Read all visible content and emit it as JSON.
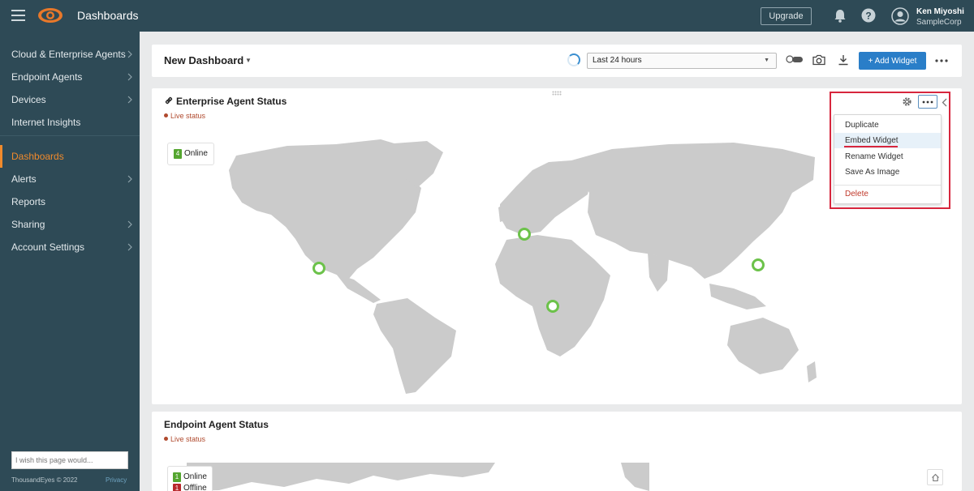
{
  "app": {
    "title": "Dashboards"
  },
  "topbar": {
    "upgrade_label": "Upgrade",
    "user_name": "Ken Miyoshi",
    "user_org": "SampleCorp"
  },
  "sidebar": {
    "items": [
      {
        "label": "Cloud & Enterprise Agents",
        "has_children": true
      },
      {
        "label": "Endpoint Agents",
        "has_children": true
      },
      {
        "label": "Devices",
        "has_children": true
      },
      {
        "label": "Internet Insights",
        "has_children": false
      },
      {
        "label": "Dashboards",
        "has_children": false,
        "active": true
      },
      {
        "label": "Alerts",
        "has_children": true
      },
      {
        "label": "Reports",
        "has_children": false
      },
      {
        "label": "Sharing",
        "has_children": true
      },
      {
        "label": "Account Settings",
        "has_children": true
      }
    ],
    "feedback_placeholder": "I wish this page would...",
    "copyright": "ThousandEyes © 2022",
    "privacy": "Privacy"
  },
  "header": {
    "dashboard_title": "New Dashboard",
    "time_range": "Last 24 hours",
    "add_widget_label": "+ Add Widget"
  },
  "widgets": [
    {
      "title": "Enterprise Agent Status",
      "live_label": "Live status",
      "legend": [
        {
          "count": "4",
          "label": "Online",
          "color": "#55a630"
        }
      ],
      "agents_online": 4
    },
    {
      "title": "Endpoint Agent Status",
      "live_label": "Live status",
      "legend": [
        {
          "count": "1",
          "label": "Online",
          "color": "#55a630"
        },
        {
          "count": "1",
          "label": "Offline",
          "color": "#b8282b"
        }
      ]
    }
  ],
  "widget_menu": {
    "items": [
      {
        "label": "Duplicate"
      },
      {
        "label": "Embed Widget",
        "highlighted": true
      },
      {
        "label": "Rename Widget"
      },
      {
        "label": "Save As Image"
      },
      {
        "label": "Delete",
        "danger": true
      }
    ]
  },
  "colors": {
    "nav_bg": "#2e4a56",
    "accent": "#f08a2c",
    "primary": "#2a7ec8",
    "online": "#55a630",
    "offline": "#b8282b",
    "highlight": "#d7263d"
  }
}
